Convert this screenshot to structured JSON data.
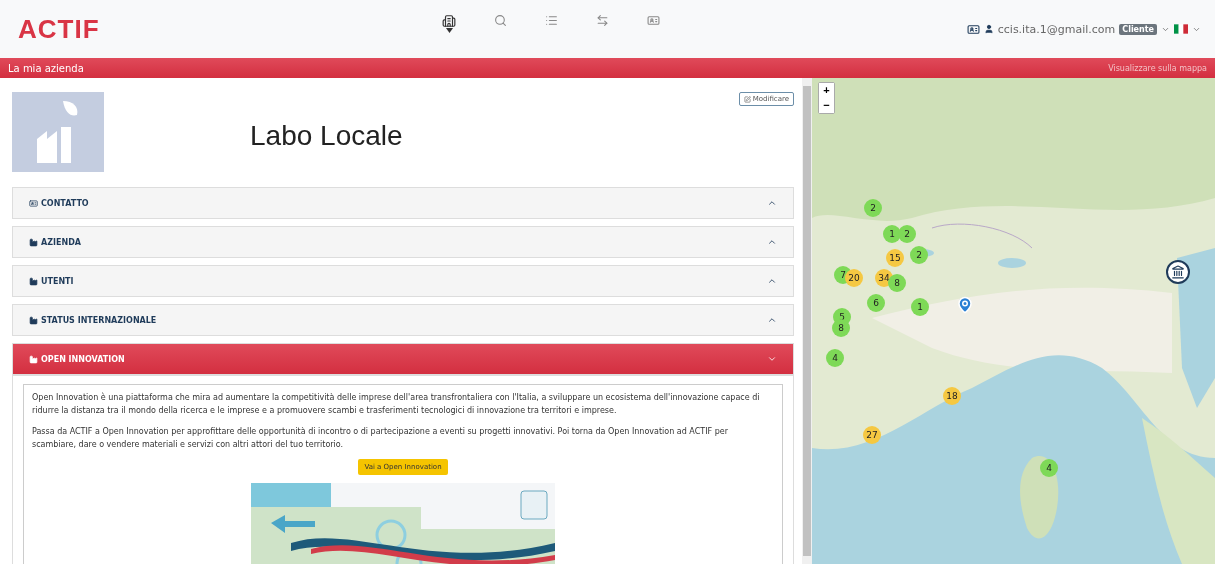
{
  "header": {
    "logo": "ACTIF",
    "nav": [
      {
        "kind": "building",
        "selected": true
      },
      {
        "kind": "search",
        "selected": false
      },
      {
        "kind": "list",
        "selected": false
      },
      {
        "kind": "exchange",
        "selected": false
      },
      {
        "kind": "card",
        "selected": false
      }
    ],
    "user": {
      "email": "ccis.ita.1@gmail.com",
      "role": "Cliente"
    }
  },
  "subbar": {
    "title": "La mia azienda",
    "link": "Visualizzare sulla mappa"
  },
  "company": {
    "name": "Labo Locale",
    "edit_button": "Modificare"
  },
  "sections": [
    {
      "kind": "contact",
      "title": "CONTATTO",
      "expanded": false
    },
    {
      "kind": "industry",
      "title": "AZIENDA",
      "expanded": false
    },
    {
      "kind": "industry",
      "title": "UTENTI",
      "expanded": false
    },
    {
      "kind": "industry",
      "title": "STATUS INTERNAZIONALE",
      "expanded": false
    },
    {
      "kind": "industry",
      "title": "OPEN INNOVATION",
      "expanded": true
    }
  ],
  "open_innovation": {
    "paragraphs": [
      "Open Innovation è una piattaforma che mira ad aumentare la competitività delle imprese dell'area transfrontaliera con l'Italia, a sviluppare un ecosistema dell'innovazione capace di ridurre la distanza tra il mondo della ricerca e le imprese e a promuovere scambi e trasferimenti tecnologici di innovazione tra territori e imprese.",
      "Passa da ACTIF a Open Innovation per approfittare delle opportunità di incontro o di partecipazione a eventi su progetti innovativi. Poi torna da Open Innovation ad ACTIF per scambiare, dare o vendere materiali e servizi con altri attori del tuo territorio."
    ],
    "button": "Vai a Open Innovation"
  },
  "map": {
    "zoom_in": "+",
    "zoom_out": "−",
    "clusters": [
      {
        "count": "2",
        "color": "#7ed957"
      },
      {
        "count": "1",
        "color": "#7ed957"
      },
      {
        "count": "2",
        "color": "#7ed957"
      },
      {
        "count": "15",
        "color": "#f5c842"
      },
      {
        "count": "2",
        "color": "#7ed957"
      },
      {
        "count": "7",
        "color": "#7ed957"
      },
      {
        "count": "20",
        "color": "#f5c842"
      },
      {
        "count": "34",
        "color": "#f5c842"
      },
      {
        "count": "8",
        "color": "#7ed957"
      },
      {
        "count": "6",
        "color": "#7ed957"
      },
      {
        "count": "1",
        "color": "#7ed957"
      },
      {
        "count": "5",
        "color": "#7ed957"
      },
      {
        "count": "8",
        "color": "#7ed957"
      },
      {
        "count": "4",
        "color": "#7ed957"
      },
      {
        "count": "18",
        "color": "#f5c842"
      },
      {
        "count": "27",
        "color": "#f5c842"
      },
      {
        "count": "4",
        "color": "#7ed957"
      }
    ]
  }
}
